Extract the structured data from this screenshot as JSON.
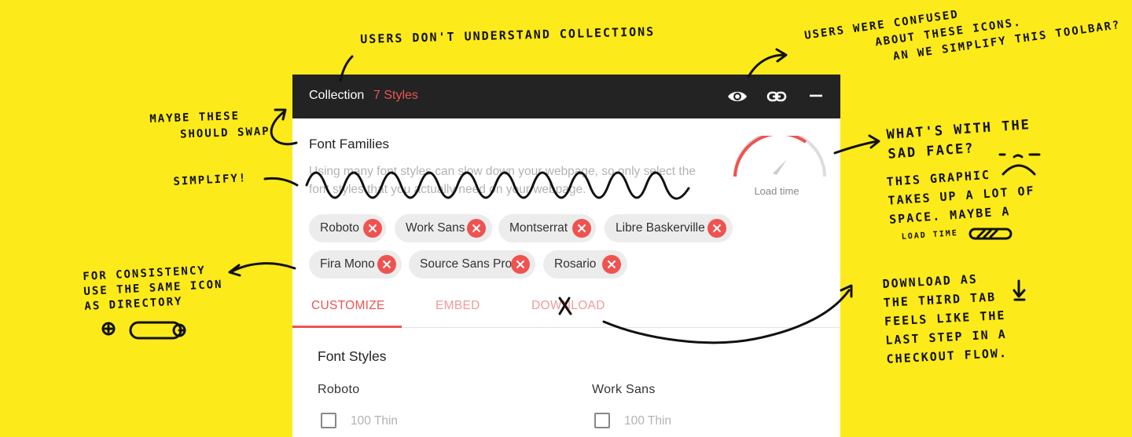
{
  "topbar": {
    "title": "Collection",
    "count": "7 Styles"
  },
  "toolbar_icons": [
    "eye-icon",
    "link-icon",
    "minimize-icon"
  ],
  "font_families": {
    "title": "Font Families",
    "description": "Using many font styles can slow down your webpage, so only select the font styles that you actually need on your webpage."
  },
  "load_time": {
    "label": "Load time"
  },
  "chips": [
    {
      "label": "Roboto"
    },
    {
      "label": "Work Sans"
    },
    {
      "label": "Montserrat"
    },
    {
      "label": "Libre Baskerville"
    },
    {
      "label": "Fira Mono"
    },
    {
      "label": "Source Sans Pro"
    },
    {
      "label": "Rosario"
    }
  ],
  "tabs": [
    {
      "label": "CUSTOMIZE",
      "active": true
    },
    {
      "label": "EMBED",
      "active": false
    },
    {
      "label": "DOWNLOAD",
      "active": false
    }
  ],
  "font_styles": {
    "title": "Font Styles",
    "families": [
      {
        "name": "Roboto",
        "option": "100 Thin"
      },
      {
        "name": "Work Sans",
        "option": "100 Thin"
      }
    ]
  },
  "colors": {
    "background": "#fdea1a",
    "topbar": "#232323",
    "accent": "#ef5350",
    "chip": "#ececec"
  },
  "annotations": {
    "collections": "Users don't understand collections",
    "icons": [
      "Users were confused",
      "about these icons.",
      "An we simplify this toolbar?"
    ],
    "swap": [
      "Maybe these",
      "should swap"
    ],
    "simplify": "Simplify!",
    "sad_face": [
      "What's with the",
      "sad face?"
    ],
    "graphic": [
      "This graphic",
      "takes up a lot of",
      "space. Maybe a",
      "load time"
    ],
    "consistency": [
      "For consistency",
      "use the same icon",
      "as directory"
    ],
    "download": [
      "Download as",
      "the third tab",
      "feels like the",
      "last step in a",
      "checkout flow."
    ]
  }
}
